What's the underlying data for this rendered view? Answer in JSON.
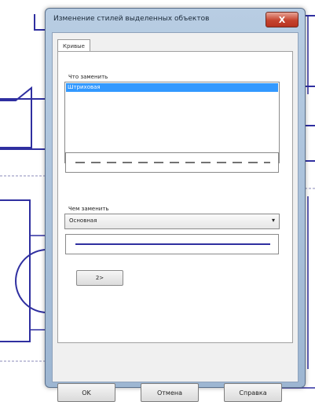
{
  "dialog": {
    "title": "Изменение стилей выделенных объектов",
    "close_label": "X"
  },
  "tabs": [
    {
      "label": "Кривые"
    }
  ],
  "replace_what": {
    "label": "Что заменить",
    "items": [
      "Штриховая"
    ],
    "preview_style": "dashed"
  },
  "replace_with": {
    "label": "Чем заменить",
    "selected": "Основная",
    "preview_style": "solid"
  },
  "arrow_button_label": "2>",
  "buttons": {
    "ok": "OK",
    "cancel": "Отмена",
    "help": "Справка"
  },
  "colors": {
    "drawing_line": "#2f2fa0",
    "selection": "#3399ff",
    "close_button": "#c5432e"
  }
}
